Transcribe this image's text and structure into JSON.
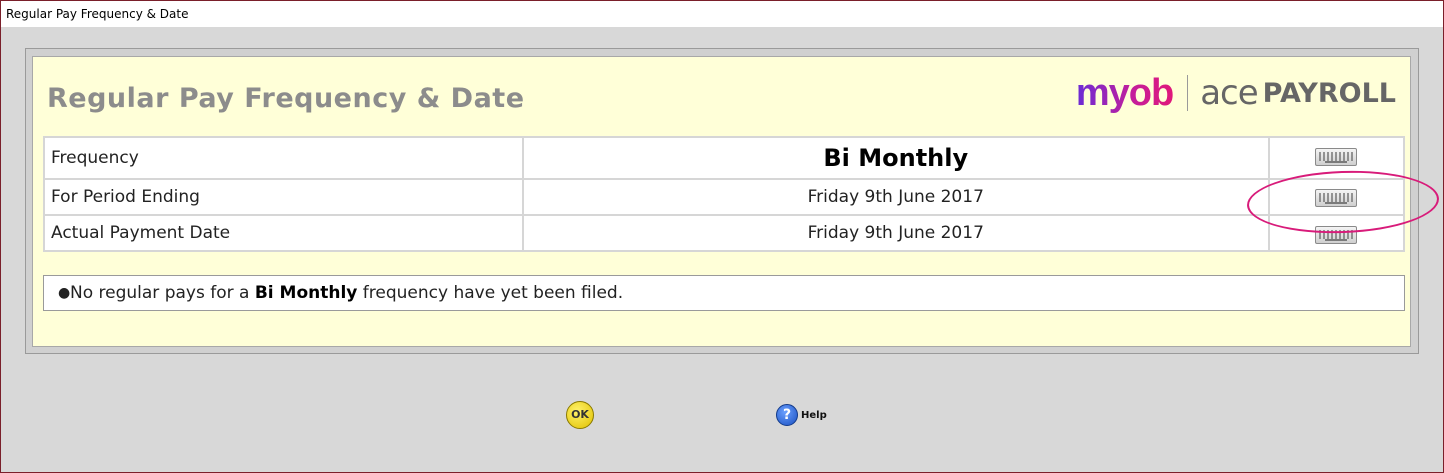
{
  "window": {
    "title": "Regular Pay Frequency & Date"
  },
  "header": {
    "title": "Regular Pay Frequency & Date",
    "logo": {
      "brand": "myob",
      "product_light": "ace",
      "product_bold": "PAYROLL"
    }
  },
  "rows": [
    {
      "label": "Frequency",
      "value": "Bi Monthly",
      "button_icon": "keyboard-icon"
    },
    {
      "label": "For Period Ending",
      "value": "Friday 9th June 2017",
      "button_icon": "keyboard-icon"
    },
    {
      "label": "Actual Payment Date",
      "value": "Friday 9th June 2017",
      "button_icon": "keyboard-icon"
    }
  ],
  "note": {
    "prefix": "No regular pays for a ",
    "emphasis": "Bi Monthly",
    "suffix": " frequency have yet been filed."
  },
  "buttons": {
    "ok_label": "OK",
    "help_label": "Help",
    "help_glyph": "?"
  },
  "colors": {
    "panel_bg": "#ffffd8",
    "annotation": "#d81b7a",
    "title_gray": "#8c8c8c"
  }
}
